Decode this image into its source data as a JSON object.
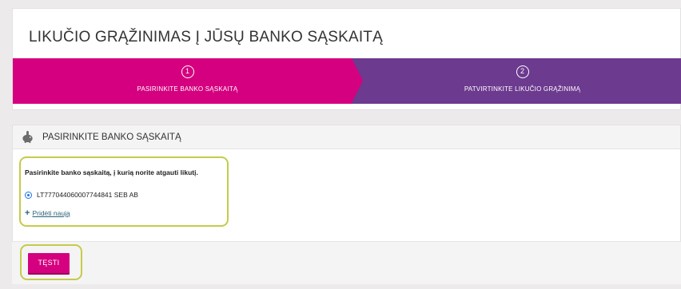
{
  "page": {
    "title": "LIKUČIO GRĄŽINIMAS Į JŪSŲ BANKO SĄSKAITĄ"
  },
  "steps": [
    {
      "number": "1",
      "label": "PASIRINKITE BANKO SĄSKAITĄ",
      "state": "active",
      "color": "#d5007f"
    },
    {
      "number": "2",
      "label": "PATVIRTINKITE LIKUČIO GRĄŽINIMĄ",
      "state": "inactive",
      "color": "#6c3a8f"
    }
  ],
  "section": {
    "title": "PASIRINKITE BANKO SĄSKAITĄ",
    "icon": "piggy-bank-icon",
    "prompt": "Pasirinkite banko sąskaitą, į kurią norite atgauti likutį.",
    "accounts": [
      {
        "label": "LT777044060007744841 SEB AB",
        "selected": true
      }
    ],
    "add_new_label": "Pridėti naują",
    "add_new_icon": "plus-icon"
  },
  "actions": {
    "submit_label": "TĘSTI"
  },
  "colors": {
    "brand_magenta": "#d5007f",
    "brand_purple": "#6c3a8f",
    "highlight": "#c5cb4a",
    "link": "#2a6478"
  }
}
